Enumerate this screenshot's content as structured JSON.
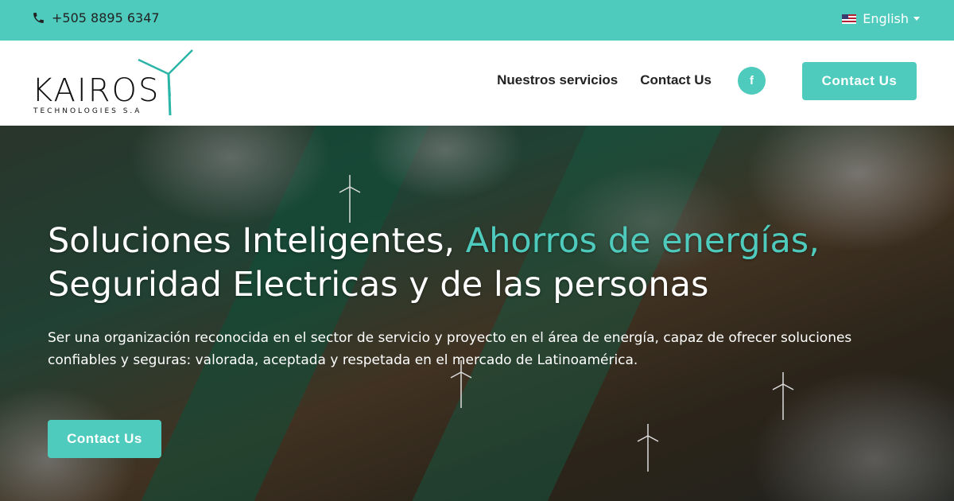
{
  "topbar": {
    "phone": "+505 8895 6347",
    "language": "English"
  },
  "navbar": {
    "logo_text": "KAIROS",
    "logo_sub": "TECHNOLOGIES S.A",
    "links": [
      {
        "label": "Nuestros servicios"
      },
      {
        "label": "Contact Us"
      }
    ],
    "facebook_label": "f",
    "cta_label": "Contact Us"
  },
  "hero": {
    "headline_part1": "Soluciones Inteligentes, ",
    "headline_accent": "Ahorros de energías,",
    "headline_line2": "Seguridad Electricas y de las personas",
    "description": "Ser una organización reconocida en el sector de servicio y proyecto en el área de energía, capaz de ofrecer soluciones confiables y seguras: valorada, aceptada y respetada en el mercado de Latinoamérica.",
    "cta_label": "Contact Us"
  },
  "colors": {
    "accent": "#4ecbbd",
    "text_dark": "#222222",
    "white": "#ffffff"
  },
  "icons": [
    "phone-icon",
    "us-flag-icon",
    "chevron-down-icon",
    "wind-turbine-icon",
    "facebook-icon"
  ]
}
